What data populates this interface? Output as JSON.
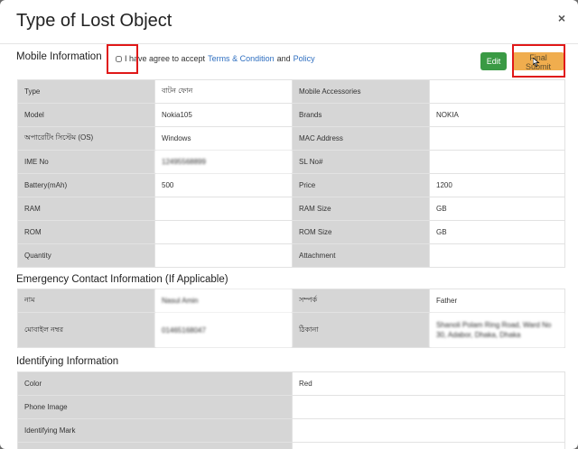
{
  "modal": {
    "title": "Type of Lost Object",
    "close_label": "×"
  },
  "mobile_section": {
    "title": "Mobile Information",
    "agree_prefix": "I have agree to accept",
    "terms_link": "Terms & Condition",
    "and_text": "and",
    "policy_link": "Policy",
    "edit_label": "Edit",
    "submit_label": "Final Submit",
    "rows": [
      {
        "label1": "Type",
        "value1": "বাটন ফোন",
        "label2": "Mobile Accessories",
        "value2": ""
      },
      {
        "label1": "Model",
        "value1": "Nokia105",
        "label2": "Brands",
        "value2": "NOKIA"
      },
      {
        "label1": "অপারেটিং সিস্টেম (OS)",
        "value1": "Windows",
        "label2": "MAC Address",
        "value2": ""
      },
      {
        "label1": "IME No",
        "value1": "12495568899",
        "label2": "SL No#",
        "value2": ""
      },
      {
        "label1": "Battery(mAh)",
        "value1": "500",
        "label2": "Price",
        "value2": "1200"
      },
      {
        "label1": "RAM",
        "value1": "",
        "label2": "RAM Size",
        "value2": "GB"
      },
      {
        "label1": "ROM",
        "value1": "",
        "label2": "ROM Size",
        "value2": "GB"
      },
      {
        "label1": "Quantity",
        "value1": "",
        "label2": "Attachment",
        "value2": ""
      }
    ]
  },
  "emergency_section": {
    "title": "Emergency Contact Information (If Applicable)",
    "rows": [
      {
        "label1": "নাম",
        "value1": "Nasul Amin",
        "label2": "সম্পর্ক",
        "value2": "Father"
      },
      {
        "label1": "মোবাইল নম্বর",
        "value1": "01465168047",
        "label2": "ঠিকানা",
        "value2": "Shanoli Polam Ring Road, Ward No 30, Adabor, Dhaka, Dhaka"
      }
    ]
  },
  "identifying_section": {
    "title": "Identifying Information",
    "rows": [
      {
        "label": "Color",
        "value": "Red"
      },
      {
        "label": "Phone Image",
        "value": ""
      },
      {
        "label": "Identifying Mark",
        "value": ""
      }
    ]
  },
  "colors": {
    "edit_button": "#3a9a44",
    "submit_button": "#f0ad4e",
    "highlight_box": "#e01818",
    "link": "#2f6fc0",
    "label_cell": "#d6d6d6"
  }
}
